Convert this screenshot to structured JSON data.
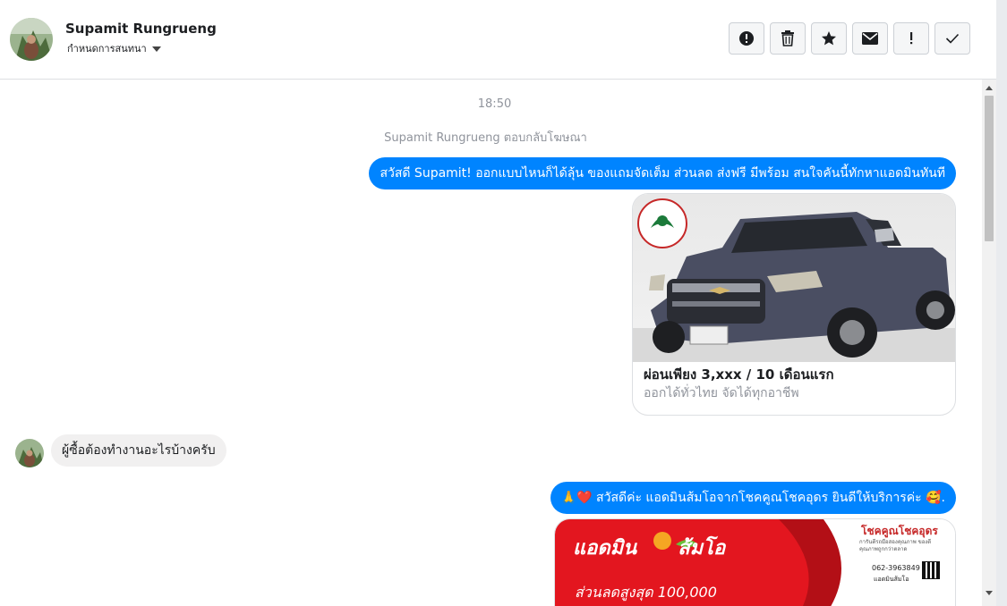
{
  "header": {
    "contact_name": "Supamit Rungrueng",
    "subtitle": "กำหนดการสนทนา"
  },
  "actions": [
    {
      "icon": "alert-circle-icon",
      "label": "Mark as spam"
    },
    {
      "icon": "trash-icon",
      "label": "Delete"
    },
    {
      "icon": "star-icon",
      "label": "Star"
    },
    {
      "icon": "envelope-icon",
      "label": "Mark as unread"
    },
    {
      "icon": "exclamation-icon",
      "label": "Follow up"
    },
    {
      "icon": "check-icon",
      "label": "Mark as done"
    }
  ],
  "conversation": {
    "timestamp": "18:50",
    "context": "Supamit Rungrueng ตอบกลับโฆษณา",
    "msg1": "สวัสดี Supamit! ออกแบบไหนก็ได้ลุ้น ของแถมจัดเต็ม ส่วนลด ส่งฟรี มีพร้อม สนใจคันนี้ทักหาแอดมินทันที",
    "card": {
      "title": "ผ่อนเพียง 3,xxx / 10 เดือนแรก",
      "subtitle": "ออกได้ทั่วไทย จัดได้ทุกอาชีพ"
    },
    "msg_in": "ผู้ซื้อต้องทำงานอะไรบ้างครับ",
    "msg2_emoji_left": "🙏❤️",
    "msg2": "สวัสดีค่ะ แอดมินส้มโอจากโชคคูณโชคอุดร ยินดีให้บริการค่ะ",
    "msg2_emoji_right": "🥰.",
    "promo": {
      "headline_left": "แอดมิน",
      "headline_right": "ส้มโอ",
      "discount": "ส่วนลดสูงสุด 100,000",
      "brand": "โชคคูณโชคอุดร",
      "brand_sub": "การันตีรถมือสองคุณภาพ ของดี คุณภาพถูกกว่าตลาด",
      "phone": "062-3963849",
      "admin_label": "แอดมินส้มโอ"
    }
  },
  "colors": {
    "outgoing": "#0084ff",
    "incoming": "#f1f0f0",
    "promo_red": "#e3161f"
  }
}
